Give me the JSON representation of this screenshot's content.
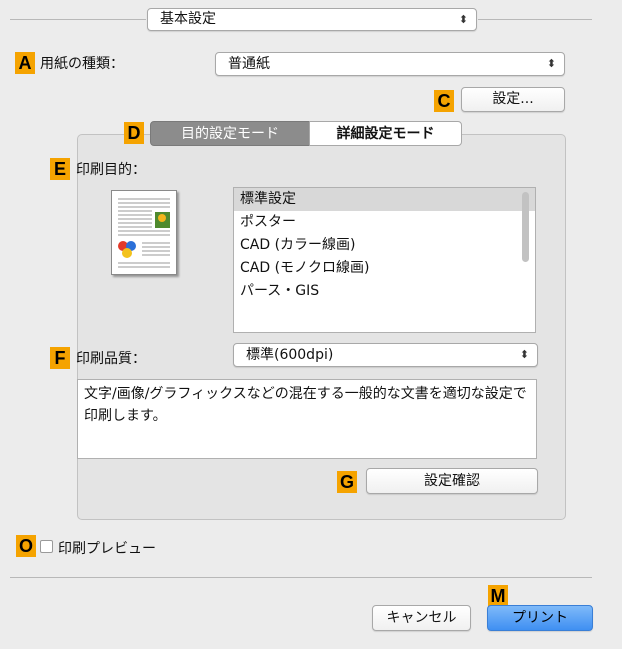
{
  "preset_popup": {
    "value": "基本設定"
  },
  "markers": {
    "A": "A",
    "C": "C",
    "D": "D",
    "E": "E",
    "F": "F",
    "G": "G",
    "O": "O",
    "M": "M"
  },
  "paper_type": {
    "label": "用紙の種類：",
    "value": "普通紙"
  },
  "settings_button": {
    "label": "設定..."
  },
  "mode_tabs": [
    {
      "label": "目的設定モード",
      "selected": true
    },
    {
      "label": "詳細設定モード",
      "selected": false
    }
  ],
  "print_purpose": {
    "label": "印刷目的：",
    "items": [
      "標準設定",
      "ポスター",
      "CAD (カラー線画)",
      "CAD (モノクロ線画)",
      "パース・GIS"
    ],
    "selected_index": 0
  },
  "print_quality": {
    "label": "印刷品質：",
    "value": "標準(600dpi)",
    "description": "文字/画像/グラフィックスなどの混在する一般的な文書を適切な設定で印刷します。"
  },
  "confirm_settings_button": {
    "label": "設定確認"
  },
  "print_preview": {
    "label": "印刷プレビュー",
    "checked": false
  },
  "footer": {
    "cancel_label": "キャンセル",
    "print_label": "プリント"
  },
  "colors": {
    "marker": "#f5a300",
    "default_button": "#4a9bf5",
    "selected_segment": "#8c8c8c"
  }
}
